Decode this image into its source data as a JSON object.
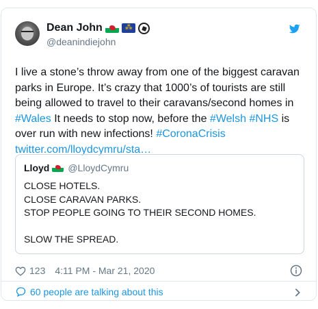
{
  "author": {
    "name": "Dean John",
    "handle": "@deanindiejohn",
    "badges": [
      "wales-flag-icon",
      "eu-flag-icon",
      "football-icon"
    ]
  },
  "tweet": {
    "parts": [
      {
        "text": "I live a stone’s throw away from one of the biggest caravan parks in Europe. It’s crazy that 1000’s of tourists are still being allowed to travel to their caravans/second homes in ",
        "link": false
      },
      {
        "text": "#Wales",
        "link": true
      },
      {
        "text": " It needs to stop now, before the ",
        "link": false
      },
      {
        "text": "#Welsh",
        "link": true
      },
      {
        "text": " ",
        "link": false
      },
      {
        "text": "#NHS",
        "link": true
      },
      {
        "text": " is over run with new infections! ",
        "link": false
      },
      {
        "text": "#CoronaCrisis",
        "link": true
      },
      {
        "text": " ",
        "link": false
      },
      {
        "text": "twitter.com/lloydcymru/sta…",
        "link": true
      }
    ]
  },
  "quoted": {
    "name": "Lloyd",
    "handle": "@LloydCymru",
    "lines": [
      "CLOSE HOTELS.",
      "CLOSE CARAVAN PARKS.",
      "STOP PEOPLE GOING TO THEIR SECOND HOMES.",
      "",
      "SLOW THE SPREAD."
    ]
  },
  "meta": {
    "likes": "123",
    "timestamp": "4:11 PM - Mar 21, 2020"
  },
  "footer": {
    "talking": "60 people are talking about this"
  },
  "colors": {
    "link": "#1b95e0",
    "secondary_text": "#657786",
    "border": "#e1e8ed"
  }
}
